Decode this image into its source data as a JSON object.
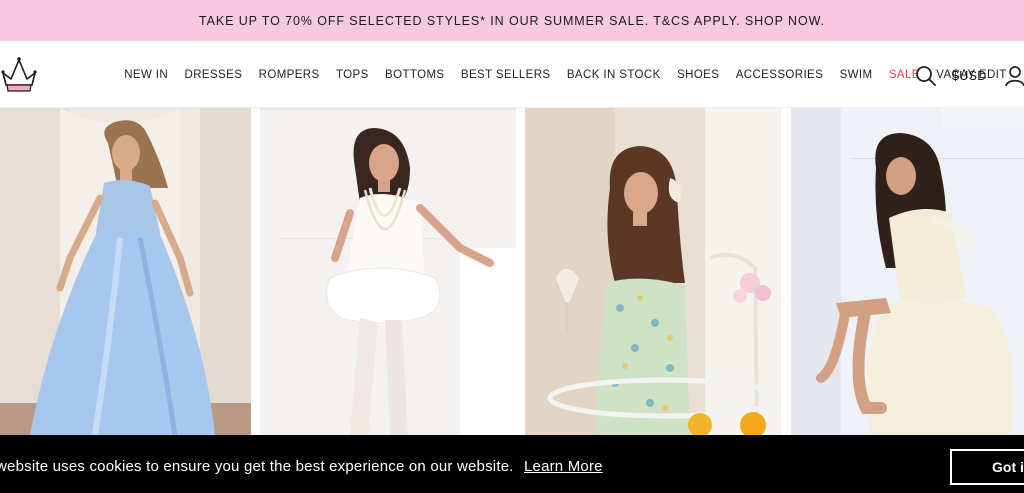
{
  "promo": {
    "text": "TAKE UP TO 70% OFF SELECTED STYLES* IN OUR SUMMER SALE. T&CS APPLY. SHOP NOW."
  },
  "header": {
    "nav": [
      {
        "label": "NEW IN"
      },
      {
        "label": "DRESSES"
      },
      {
        "label": "ROMPERS"
      },
      {
        "label": "TOPS"
      },
      {
        "label": "BOTTOMS"
      },
      {
        "label": "BEST SELLERS"
      },
      {
        "label": "BACK IN STOCK"
      },
      {
        "label": "SHOES"
      },
      {
        "label": "ACCESSORIES"
      },
      {
        "label": "SWIM"
      },
      {
        "label": "SALE"
      },
      {
        "label": "VACAY EDIT"
      }
    ],
    "currency": "$USD",
    "icons": {
      "logo": "crown-logo",
      "search": "search-icon",
      "account": "user-icon"
    }
  },
  "products": [
    {
      "image": "model-in-blue-satin-maxi-dress"
    },
    {
      "image": "model-in-white-mini-dress-pearls"
    },
    {
      "image": "model-in-floral-strapless-dress"
    },
    {
      "image": "model-in-cream-lace-mini-dress"
    }
  ],
  "cookie": {
    "text": "website uses cookies to ensure you get the best experience on our website.",
    "link_label": "Learn More",
    "button_label": "Got it"
  },
  "colors": {
    "promo_bg": "#f6c9de",
    "sale": "#e0414b",
    "cookie_bg": "#000000",
    "logo_pink": "#f2a9c8"
  }
}
